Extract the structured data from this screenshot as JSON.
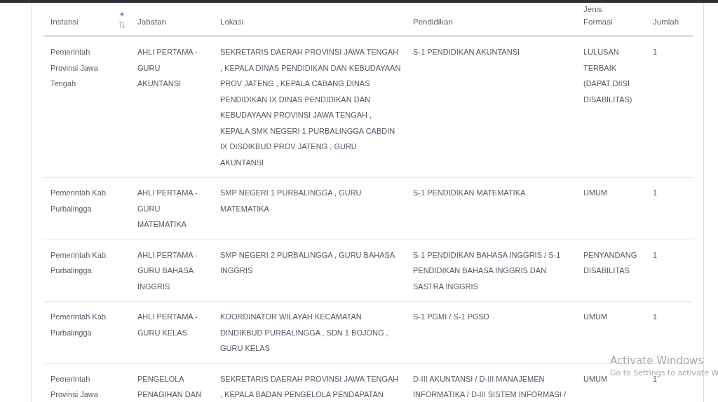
{
  "table": {
    "columns": [
      {
        "label": "Instansi",
        "sorted_ascending": true
      },
      {
        "label": "Jabatan",
        "sorted_ascending": false
      },
      {
        "label": "Lokasi",
        "sorted_ascending": false
      },
      {
        "label": "Pendidikan",
        "sorted_ascending": false
      },
      {
        "label": "Jenis Formasi",
        "sorted_ascending": false
      },
      {
        "label": "Jumlah",
        "sorted_ascending": false
      }
    ],
    "rows": [
      [
        "Pemerintah Provinsi Jawa Tengah",
        "AHLI PERTAMA - GURU AKUNTANSI",
        "SEKRETARIS DAERAH PROVINSI JAWA TENGAH , KEPALA DINAS PENDIDIKAN DAN KEBUDAYAAN PROV JATENG , KEPALA CABANG DINAS PENDIDIKAN IX DINAS PENDIDIKAN DAN KEBUDAYAAN PROVINSI JAWA TENGAH , KEPALA SMK NEGERI 1 PURBALINGGA CABDIN IX DISDIKBUD PROV JATENG , GURU AKUNTANSI",
        "S-1 PENDIDIKAN AKUNTANSI",
        "LULUSAN TERBAIK (DAPAT DIISI DISABILITAS)",
        "1"
      ],
      [
        "Pemerintah Kab. Purbalingga",
        "AHLI PERTAMA - GURU MATEMATIKA",
        "SMP NEGERI 1 PURBALINGGA , GURU MATEMATIKA",
        "S-1 PENDIDIKAN MATEMATIKA",
        "UMUM",
        "1"
      ],
      [
        "Pemerintah Kab. Purbalingga",
        "AHLI PERTAMA - GURU BAHASA INGGRIS",
        "SMP NEGERI 2 PURBALINGGA , GURU BAHASA INGGRIS",
        "S-1 PENDIDIKAN BAHASA INGGRIS / S-1 PENDIDIKAN BAHASA INGGRIS DAN SASTRA INGGRIS",
        "PENYANDANG DISABILITAS",
        "1"
      ],
      [
        "Pemerintah Kab. Purbalingga",
        "AHLI PERTAMA - GURU KELAS",
        "KOORDINATOR WILAYAH KECAMATAN DINDIKBUD PURBALINGGA , SDN 1 BOJONG , GURU KELAS",
        "S-1 PGMI / S-1 PGSD",
        "UMUM",
        "1"
      ],
      [
        "Pemerintah Provinsi Jawa",
        "PENGELOLA PENAGIHAN DAN",
        "SEKRETARIS DAERAH PROVINSI JAWA TENGAH , KEPALA BADAN PENGELOLA PENDAPATAN",
        "D-III AKUNTANSI / D-III MANAJEMEN INFORMATIKA / D-III SISTEM INFORMASI /",
        "UMUM",
        "1"
      ]
    ]
  },
  "os_notice": {
    "title": "Activate Windows",
    "subtitle": "Go to Settings to activate W"
  }
}
